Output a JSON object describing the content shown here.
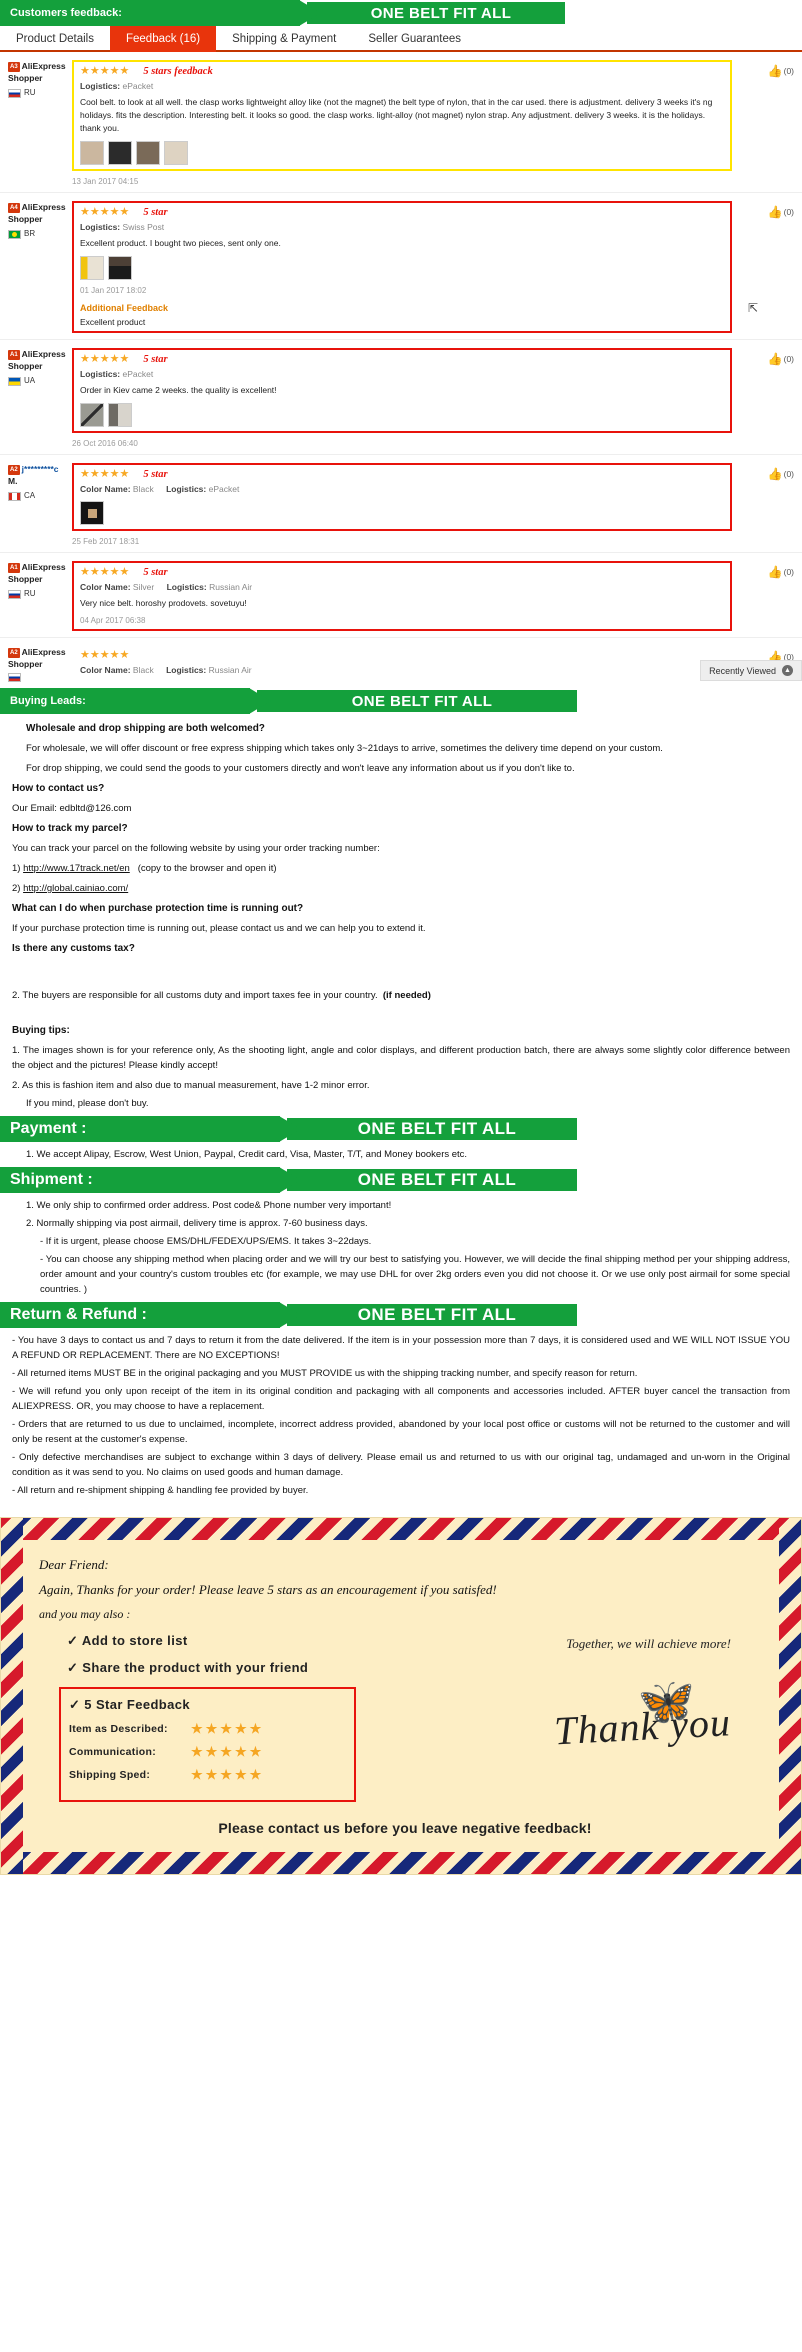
{
  "header": {
    "banner_label": "Customers feedback:",
    "banner_slogan": "ONE BELT FIT ALL"
  },
  "tabs": [
    {
      "label": "Product Details",
      "active": false
    },
    {
      "label": "Feedback (16)",
      "active": true
    },
    {
      "label": "Shipping & Payment",
      "active": false
    },
    {
      "label": "Seller Guarantees",
      "active": false
    }
  ],
  "feedback": [
    {
      "badge": "A3",
      "user_name": "AliExpress",
      "user_name2": "Shopper",
      "country": "RU",
      "stars": "★★★★★",
      "note": "5 stars feedback",
      "logistics_label": "Logistics:",
      "logistics_value": "ePacket",
      "text": "Cool belt. to look at all well. the clasp works lightweight alloy like (not the magnet) the belt type of nylon, that in the car used. there is adjustment. delivery 3 weeks it's ng holidays. fits the description. Interesting belt. it looks so good. the clasp works. light-alloy (not magnet) nylon strap. Any adjustment. delivery 3 weeks. it is the holidays. thank you.",
      "date": "13 Jan 2017 04:15",
      "likes": "(0)",
      "thumbs": 4,
      "outline": "yellow"
    },
    {
      "badge": "A4",
      "user_name": "AliExpress",
      "user_name2": "Shopper",
      "country": "BR",
      "stars": "★★★★★",
      "note": "5 star",
      "logistics_label": "Logistics:",
      "logistics_value": "Swiss Post",
      "text": "Excellent product. I bought two pieces, sent only one.",
      "date": "01 Jan 2017 18:02",
      "likes": "(0)",
      "thumbs": 2,
      "outline": "red",
      "additional_label": "Additional Feedback",
      "additional_text": "Excellent product"
    },
    {
      "badge": "A1",
      "user_name": "AliExpress",
      "user_name2": "Shopper",
      "country": "UA",
      "stars": "★★★★★",
      "note": "5 star",
      "logistics_label": "Logistics:",
      "logistics_value": "ePacket",
      "text": "Order in Kiev came 2 weeks. the quality is excellent!",
      "date": "26 Oct 2016 06:40",
      "likes": "(0)",
      "thumbs": 2,
      "outline": "red"
    },
    {
      "badge": "A2",
      "user_name": "j*********c",
      "user_name2": "M.",
      "country": "CA",
      "stars": "★★★★★",
      "note": "5 star",
      "color_label": "Color Name:",
      "color_value": "Black",
      "logistics_label": "Logistics:",
      "logistics_value": "ePacket",
      "text": "",
      "date": "25 Feb 2017 18:31",
      "likes": "(0)",
      "thumbs": 1,
      "outline": "red"
    },
    {
      "badge": "A1",
      "user_name": "AliExpress",
      "user_name2": "Shopper",
      "country": "RU",
      "stars": "★★★★★",
      "note": "5 star",
      "color_label": "Color Name:",
      "color_value": "Silver",
      "logistics_label": "Logistics:",
      "logistics_value": "Russian Air",
      "text": "Very nice belt. horoshy prodovets. sovetuyu!",
      "date": "04 Apr 2017 06:38",
      "likes": "(0)",
      "thumbs": 0,
      "outline": "red"
    },
    {
      "badge": "A2",
      "user_name": "AliExpress",
      "user_name2": "Shopper",
      "country": "RU",
      "stars": "★★★★★",
      "note": "",
      "color_label": "Color Name:",
      "color_value": "Black",
      "logistics_label": "Logistics:",
      "logistics_value": "Russian Air",
      "text": "",
      "date": "",
      "likes": "(0)",
      "thumbs": 0,
      "outline": "none"
    }
  ],
  "recently_viewed": {
    "label": "Recently Viewed",
    "icon": "collapse-icon"
  },
  "buying_leads": {
    "banner_label": "Buying Leads:",
    "banner_slogan": "ONE BELT FIT ALL",
    "q1": "Wholesale and drop shipping are both welcomed?",
    "p1": "For wholesale, we will offer discount or free express shipping which takes only 3~21days to arrive, sometimes the delivery time depend on your custom.",
    "p2": "For drop shipping, we could send the goods to your customers directly and won't leave any information about us if you don't like to.",
    "q2": "How to contact us?",
    "p3": "Our Email: edbltd@126.com",
    "q3": "How to track my parcel?",
    "p4": "You can track your parcel on the following website by using your order tracking number:",
    "link1_prefix": "1) ",
    "link1": "http://www.17track.net/en",
    "link1_suffix": "(copy to the browser and open it)",
    "link2_prefix": "2) ",
    "link2": "http://global.cainiao.com/",
    "q4": "What can I do when purchase protection time is running out?",
    "p5": "If your purchase protection time is running out, please contact us and we can help you to extend it.",
    "q5": "Is there any customs tax?",
    "p6": "2. The buyers are responsible for all customs duty and import taxes fee in your country.",
    "p6_bold": "(if needed)",
    "q6": "Buying tips:",
    "p7": "1. The images shown is for your reference only, As the shooting light, angle and color displays, and different production batch, there are always some slightly color difference between the object and the pictures! Please kindly accept!",
    "p8": "2. As this is fashion item and also due to manual measurement, have 1-2 minor error.",
    "p9": "If you mind, please don't buy."
  },
  "payment": {
    "banner_label": "Payment :",
    "banner_slogan": "ONE BELT FIT ALL",
    "p1": "1. We accept Alipay, Escrow, West Union, Paypal, Credit card, Visa, Master, T/T, and Money bookers etc."
  },
  "shipment": {
    "banner_label": "Shipment :",
    "banner_slogan": "ONE BELT FIT ALL",
    "p1": "1. We only ship to confirmed order address. Post code& Phone number very important!",
    "p2": "2. Normally shipping via post airmail, delivery time is approx. 7-60 business days.",
    "p3": "- If it is urgent, please choose EMS/DHL/FEDEX/UPS/EMS. It takes 3~22days.",
    "p4": "- You can choose any shipping method when placing order and we will try our best to satisfying you. However, we will decide the final shipping method per your shipping address, order amount and your country's custom troubles etc (for example, we may use DHL for over 2kg orders even you did not choose it. Or we use only post airmail for some special countries. )"
  },
  "return_refund": {
    "banner_label": "Return & Refund :",
    "banner_slogan": "ONE BELT FIT ALL",
    "p1": "- You have 3 days to contact us and 7 days to return it from the date delivered. If the item is in your possession more than 7 days, it is considered used and WE WILL NOT ISSUE YOU A REFUND OR REPLACEMENT. There are NO EXCEPTIONS!",
    "p2": "- All returned items MUST BE in the original packaging and you MUST PROVIDE us with the shipping tracking number, and specify reason for return.",
    "p3": "- We will refund you only upon receipt of the item in its original condition and packaging with all components and accessories included. AFTER buyer cancel the transaction from ALIEXPRESS. OR, you may choose to have a replacement.",
    "p4": "- Orders that are returned to us due to unclaimed, incomplete, incorrect address provided, abandoned by your local post office or customs will not be returned to the customer and will only be resent at the customer's expense.",
    "p5": "- Only defective merchandises are subject to exchange within 3 days of delivery. Please email us and returned to us with our original tag, undamaged and un-worn in the Original condition as it was send to you. No claims on used goods and human damage.",
    "p6": "- All return and re-shipment shipping & handling fee provided by buyer."
  },
  "thankyou_card": {
    "greeting": "Dear Friend:",
    "line1": "Again, Thanks for your order! Please leave 5 stars as an encouragement if you satisfed!",
    "line2": "and you may also :",
    "check1": "✓ Add to store list",
    "check2": "✓ Share the product with your friend",
    "check3": "✓ 5 Star Feedback",
    "together": "Together, we will achieve more!",
    "thankyou": "Thank you",
    "ratings": [
      {
        "label": "Item as Described:",
        "stars": "★★★★★"
      },
      {
        "label": "Communication:",
        "stars": "★★★★★"
      },
      {
        "label": "Shipping Sped:",
        "stars": "★★★★★"
      }
    ],
    "footer": "Please contact us before you leave negative feedback!",
    "butterfly_icon": "butterfly-icon"
  },
  "colors": {
    "green": "#14a03c",
    "red": "#e8130c",
    "orange": "#e8340c",
    "star": "#f7a823",
    "yellow_outline": "#ffe400",
    "paper": "#fdeec5"
  }
}
